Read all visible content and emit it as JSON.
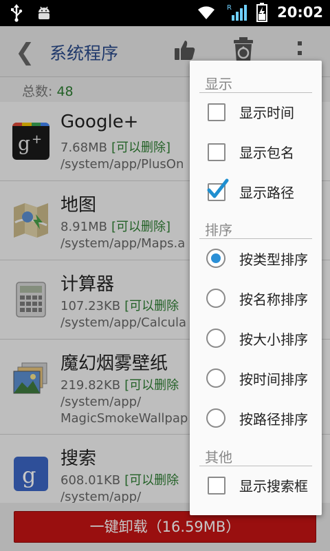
{
  "status_bar": {
    "time": "20:02",
    "icons": [
      "usb-icon",
      "android-debug-icon",
      "wifi-icon",
      "signal-icon",
      "battery-charging-icon"
    ],
    "signal_label": "R"
  },
  "action_bar": {
    "title": "系统程序",
    "back_glyph": "❮",
    "icons": [
      "thumbs-up-icon",
      "recycle-bin-icon",
      "overflow-menu-icon"
    ]
  },
  "summary": {
    "total_label": "总数: ",
    "total_value": "48"
  },
  "apps": [
    {
      "name": "Google+",
      "size": "7.68MB",
      "status": "[可以删除]",
      "path": "/system/app/PlusOn",
      "icon": "google-plus-icon"
    },
    {
      "name": "地图",
      "size": "8.91MB",
      "status": "[可以删除]",
      "path": "/system/app/Maps.a",
      "icon": "maps-icon"
    },
    {
      "name": "计算器",
      "size": "107.23KB",
      "status": "[可以删除",
      "path": "/system/app/Calcula",
      "icon": "calculator-icon"
    },
    {
      "name": "魔幻烟雾壁纸",
      "size": "219.82KB",
      "status": "[可以删除",
      "path": "/system/app/",
      "path2": "MagicSmokeWallpap",
      "icon": "wallpaper-icon"
    },
    {
      "name": "搜索",
      "size": "608.01KB",
      "status": "[可以删除",
      "path": "/system/app/",
      "icon": "google-search-icon"
    }
  ],
  "bottom": {
    "uninstall_label": "一键卸载（16.59MB）"
  },
  "menu": {
    "section_display": "显示",
    "show_time": {
      "label": "显示时间",
      "checked": false
    },
    "show_package": {
      "label": "显示包名",
      "checked": false
    },
    "show_path": {
      "label": "显示路径",
      "checked": true
    },
    "section_sort": "排序",
    "sort_options": [
      {
        "label": "按类型排序",
        "selected": true
      },
      {
        "label": "按名称排序",
        "selected": false
      },
      {
        "label": "按大小排序",
        "selected": false
      },
      {
        "label": "按时间排序",
        "selected": false
      },
      {
        "label": "按路径排序",
        "selected": false
      }
    ],
    "section_other": "其他",
    "show_search": {
      "label": "显示搜索框",
      "checked": false
    }
  },
  "colors": {
    "accent_green": "#2e7d32",
    "title_blue": "#2a4a8a",
    "uninstall_red": "#c41414",
    "radio_blue": "#2a8fd6",
    "check_blue": "#1f8fd0"
  }
}
